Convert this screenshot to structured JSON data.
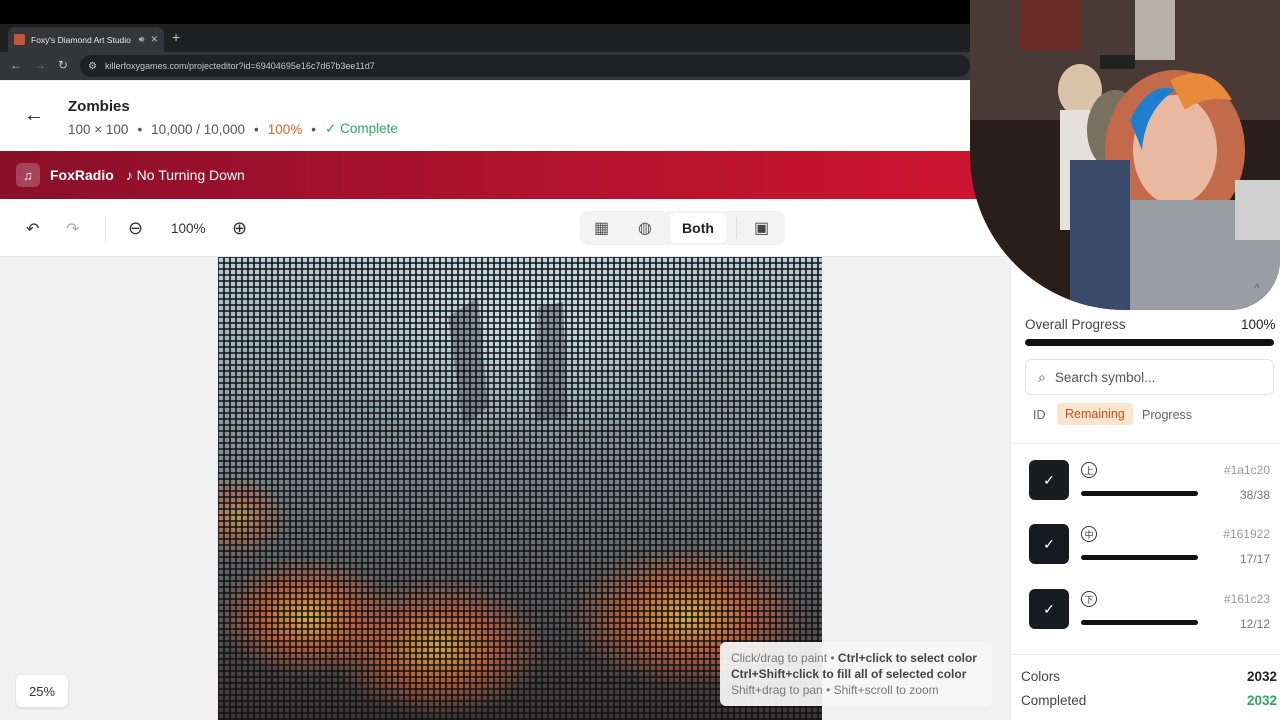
{
  "browser": {
    "tab_title": "Foxy's Diamond Art Studio",
    "tab_close": "✕",
    "new_tab": "+",
    "url": "killerfoxygames.com/projecteditor?id=69404695e16c7d67b3ee11d7"
  },
  "project": {
    "back_icon": "←",
    "title": "Zombies",
    "dimensions": "100 × 100",
    "sep1": "•",
    "counts": "10,000 / 10,000",
    "sep2": "•",
    "percent": "100%",
    "sep3": "•",
    "status": "✓ Complete"
  },
  "radio": {
    "icon": "♫",
    "name": "FoxRadio",
    "song": "♪ No Turning Down"
  },
  "toolbar": {
    "undo": "↶",
    "redo": "↷",
    "zoom_out": "⊖",
    "zoom_value": "100%",
    "zoom_in": "⊕",
    "grid_icon": "▦",
    "palette_icon": "◍",
    "both_label": "Both",
    "image_icon": "▣"
  },
  "canvas": {
    "zoom_badge": "25%",
    "help": {
      "line1_plain": "Click/drag to paint • ",
      "line1_bold": "Ctrl+click to select color",
      "line2_bold": "Ctrl+Shift+click to fill all of selected color",
      "line3": "Shift+drag to pan • Shift+scroll to zoom"
    }
  },
  "panel": {
    "collapse_icon": "^",
    "overall_label": "Overall Progress",
    "overall_value": "100%",
    "overall_fraction": 1.0,
    "search_placeholder": "Search symbol...",
    "sort_tabs": [
      "ID",
      "Remaining",
      "Progress"
    ],
    "active_sort": "Remaining",
    "colors": [
      {
        "symbol": "上",
        "hex": "#1a1c20",
        "count": "38/38",
        "progress": 1.0,
        "check": "✓"
      },
      {
        "symbol": "中",
        "hex": "#161922",
        "count": "17/17",
        "progress": 1.0,
        "check": "✓"
      },
      {
        "symbol": "下",
        "hex": "#161c23",
        "count": "12/12",
        "progress": 1.0,
        "check": "✓"
      }
    ],
    "stats": {
      "colors_label": "Colors",
      "colors_value": "2032",
      "completed_label": "Completed",
      "completed_value": "2032"
    }
  },
  "theme": {
    "accent_orange": "#e0602a",
    "complete_green": "#2aa860",
    "radio_red": "#b2122e"
  }
}
